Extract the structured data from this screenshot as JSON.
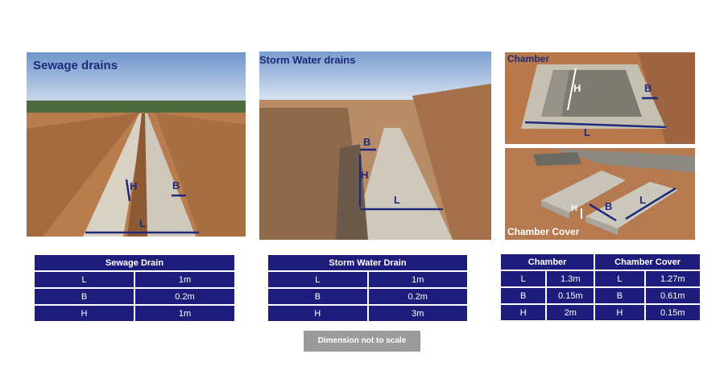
{
  "photos": {
    "sewage": {
      "title": "Sewage drains",
      "labels": {
        "h": "H",
        "b": "B",
        "l": "L"
      }
    },
    "storm": {
      "title": "Storm Water drains",
      "labels": {
        "b": "B",
        "h": "H",
        "l": "L"
      }
    },
    "chamber": {
      "title": "Chamber",
      "labels": {
        "h": "H",
        "b": "B",
        "l": "L"
      }
    },
    "cover": {
      "title": "Chamber Cover",
      "labels": {
        "h": "H",
        "b": "B",
        "l": "L"
      }
    }
  },
  "tables": {
    "sewage": {
      "header": "Sewage Drain",
      "rows": [
        {
          "dim": "L",
          "value": "1m"
        },
        {
          "dim": "B",
          "value": "0.2m"
        },
        {
          "dim": "H",
          "value": "1m"
        }
      ]
    },
    "storm": {
      "header": "Storm Water Drain",
      "rows": [
        {
          "dim": "L",
          "value": "1m"
        },
        {
          "dim": "B",
          "value": "0.2m"
        },
        {
          "dim": "H",
          "value": "3m"
        }
      ]
    },
    "chamber": {
      "header_chamber": "Chamber",
      "header_cover": "Chamber Cover",
      "rows": [
        {
          "dim": "L",
          "chamber": "1.3m",
          "dim2": "L",
          "cover": "1.27m"
        },
        {
          "dim": "B",
          "chamber": "0.15m",
          "dim2": "B",
          "cover": "0.61m"
        },
        {
          "dim": "H",
          "chamber": "2m",
          "dim2": "H",
          "cover": "0.15m"
        }
      ]
    }
  },
  "note": "Dimension not to scale",
  "colors": {
    "accent": "#1f2a7a",
    "table_bg": "#1f1d7c",
    "note_bg": "#9b9b9b"
  }
}
